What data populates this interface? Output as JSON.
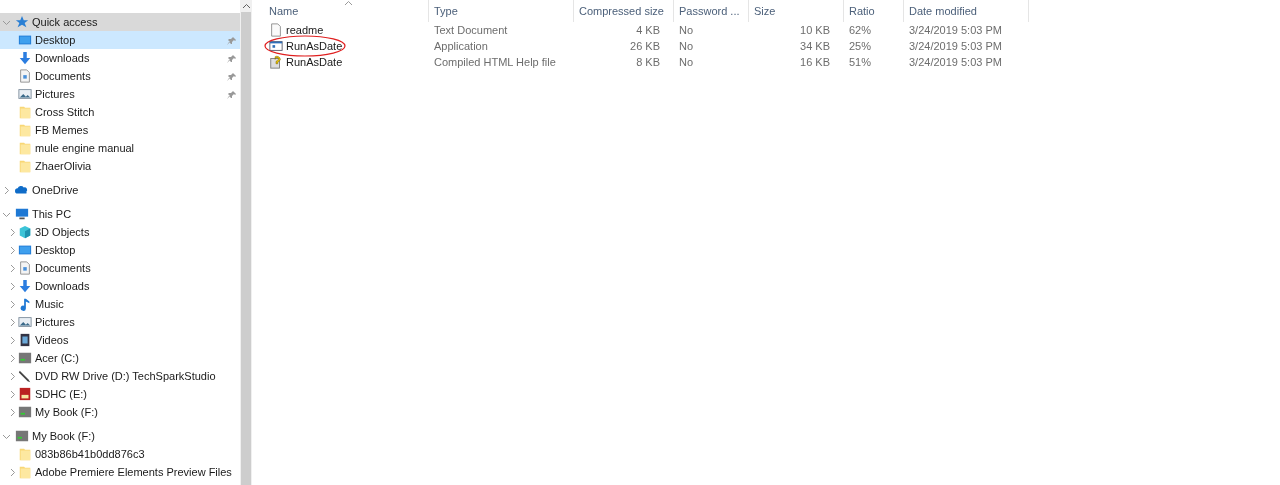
{
  "sidebar": {
    "tree": [
      {
        "label": "Quick access",
        "kind": "star",
        "expanded": true,
        "selected": false,
        "hovered": true,
        "children": [
          {
            "label": "Desktop",
            "kind": "desktop",
            "pinned": true,
            "selected": true
          },
          {
            "label": "Downloads",
            "kind": "download",
            "pinned": true,
            "selected": false
          },
          {
            "label": "Documents",
            "kind": "document",
            "pinned": true,
            "selected": false
          },
          {
            "label": "Pictures",
            "kind": "picture",
            "pinned": true,
            "selected": false
          },
          {
            "label": "Cross Stitch",
            "kind": "folder",
            "pinned": false,
            "selected": false
          },
          {
            "label": "FB Memes",
            "kind": "folder",
            "pinned": false,
            "selected": false
          },
          {
            "label": "mule engine manual",
            "kind": "folder",
            "pinned": false,
            "selected": false
          },
          {
            "label": "ZhaerOlivia",
            "kind": "folder",
            "pinned": false,
            "selected": false
          }
        ]
      },
      {
        "label": "OneDrive",
        "kind": "cloud",
        "expanded": false,
        "selected": false
      },
      {
        "label": "This PC",
        "kind": "pc",
        "expanded": true,
        "selected": false,
        "children": [
          {
            "label": "3D Objects",
            "kind": "cube",
            "expanded": false,
            "selected": false
          },
          {
            "label": "Desktop",
            "kind": "desktop",
            "expanded": false,
            "selected": false
          },
          {
            "label": "Documents",
            "kind": "document",
            "expanded": false,
            "selected": false
          },
          {
            "label": "Downloads",
            "kind": "download",
            "expanded": false,
            "selected": false
          },
          {
            "label": "Music",
            "kind": "music",
            "expanded": false,
            "selected": false
          },
          {
            "label": "Pictures",
            "kind": "picture",
            "expanded": false,
            "selected": false
          },
          {
            "label": "Videos",
            "kind": "video",
            "expanded": false,
            "selected": false
          },
          {
            "label": "Acer (C:)",
            "kind": "drive",
            "expanded": false,
            "selected": false
          },
          {
            "label": "DVD RW Drive (D:) TechSparkStudio",
            "kind": "dvd",
            "expanded": false,
            "selected": false
          },
          {
            "label": "SDHC (E:)",
            "kind": "sd",
            "expanded": false,
            "selected": false
          },
          {
            "label": "My Book (F:)",
            "kind": "drive",
            "expanded": false,
            "selected": false
          }
        ]
      },
      {
        "label": "My Book (F:)",
        "kind": "drive",
        "expanded": true,
        "selected": false,
        "children": [
          {
            "label": "083b86b41b0dd876c3",
            "kind": "folder",
            "selected": false
          },
          {
            "label": "Adobe Premiere Elements Preview Files",
            "kind": "folder",
            "expanded": false,
            "selected": false
          }
        ]
      }
    ]
  },
  "table": {
    "columns": [
      {
        "label": "Name",
        "sorted": true
      },
      {
        "label": "Type"
      },
      {
        "label": "Compressed size"
      },
      {
        "label": "Password ..."
      },
      {
        "label": "Size"
      },
      {
        "label": "Ratio"
      },
      {
        "label": "Date modified"
      }
    ],
    "rows": [
      {
        "kind": "text",
        "cells": [
          "readme",
          "Text Document",
          "4 KB",
          "No",
          "10 KB",
          "62%",
          "3/24/2019 5:03 PM"
        ]
      },
      {
        "kind": "app",
        "circled": true,
        "cells": [
          "RunAsDate",
          "Application",
          "26 KB",
          "No",
          "34 KB",
          "25%",
          "3/24/2019 5:03 PM"
        ]
      },
      {
        "kind": "help",
        "cells": [
          "RunAsDate",
          "Compiled HTML Help file",
          "8 KB",
          "No",
          "16 KB",
          "51%",
          "3/24/2019 5:03 PM"
        ]
      }
    ]
  }
}
